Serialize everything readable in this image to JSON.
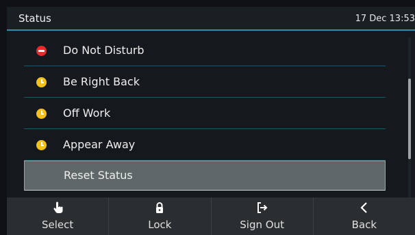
{
  "header": {
    "title": "Status",
    "datetime": "17 Dec 13:53"
  },
  "status_list": [
    {
      "label": "Do Not Disturb",
      "icon": "do-not-disturb-icon",
      "color": "#e52b2b"
    },
    {
      "label": "Be Right Back",
      "icon": "clock-icon",
      "color": "#f2c21b"
    },
    {
      "label": "Off Work",
      "icon": "clock-icon",
      "color": "#f2c21b"
    },
    {
      "label": "Appear Away",
      "icon": "clock-icon",
      "color": "#f2c21b"
    },
    {
      "label": "Reset Status",
      "selected": true
    }
  ],
  "softkeys": [
    {
      "label": "Select",
      "icon": "hand-pointer-icon"
    },
    {
      "label": "Lock",
      "icon": "lock-icon"
    },
    {
      "label": "Sign Out",
      "icon": "sign-out-icon"
    },
    {
      "label": "Back",
      "icon": "chevron-left-icon"
    }
  ],
  "colors": {
    "accent": "#2e8fb0",
    "selected_row": "#5f6768",
    "softkey_bar": "#2b2e31"
  }
}
